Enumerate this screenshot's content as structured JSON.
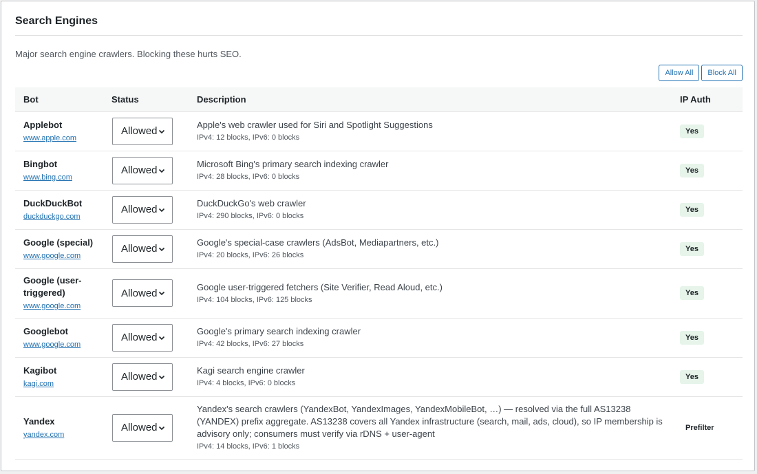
{
  "section": {
    "title": "Search Engines",
    "subtitle": "Major search engine crawlers. Blocking these hurts SEO."
  },
  "actions": {
    "allow_all": "Allow All",
    "block_all": "Block All"
  },
  "table": {
    "headers": {
      "bot": "Bot",
      "status": "Status",
      "description": "Description",
      "ip_auth": "IP Auth"
    },
    "rows": [
      {
        "name": "Applebot",
        "link": "www.apple.com",
        "status": "Allowed",
        "description": "Apple's web crawler used for Siri and Spotlight Suggestions",
        "blocks": "IPv4: 12 blocks, IPv6: 0 blocks",
        "ip_auth": "Yes",
        "ip_auth_kind": "yes"
      },
      {
        "name": "Bingbot",
        "link": "www.bing.com",
        "status": "Allowed",
        "description": "Microsoft Bing's primary search indexing crawler",
        "blocks": "IPv4: 28 blocks, IPv6: 0 blocks",
        "ip_auth": "Yes",
        "ip_auth_kind": "yes"
      },
      {
        "name": "DuckDuckBot",
        "link": "duckduckgo.com",
        "status": "Allowed",
        "description": "DuckDuckGo's web crawler",
        "blocks": "IPv4: 290 blocks, IPv6: 0 blocks",
        "ip_auth": "Yes",
        "ip_auth_kind": "yes"
      },
      {
        "name": "Google (special)",
        "link": "www.google.com",
        "status": "Allowed",
        "description": "Google's special-case crawlers (AdsBot, Mediapartners, etc.)",
        "blocks": "IPv4: 20 blocks, IPv6: 26 blocks",
        "ip_auth": "Yes",
        "ip_auth_kind": "yes"
      },
      {
        "name": "Google (user-triggered)",
        "link": "www.google.com",
        "status": "Allowed",
        "description": "Google user-triggered fetchers (Site Verifier, Read Aloud, etc.)",
        "blocks": "IPv4: 104 blocks, IPv6: 125 blocks",
        "ip_auth": "Yes",
        "ip_auth_kind": "yes"
      },
      {
        "name": "Googlebot",
        "link": "www.google.com",
        "status": "Allowed",
        "description": "Google's primary search indexing crawler",
        "blocks": "IPv4: 42 blocks, IPv6: 27 blocks",
        "ip_auth": "Yes",
        "ip_auth_kind": "yes"
      },
      {
        "name": "Kagibot",
        "link": "kagi.com",
        "status": "Allowed",
        "description": "Kagi search engine crawler",
        "blocks": "IPv4: 4 blocks, IPv6: 0 blocks",
        "ip_auth": "Yes",
        "ip_auth_kind": "yes"
      },
      {
        "name": "Yandex",
        "link": "yandex.com",
        "status": "Allowed",
        "description": "Yandex's search crawlers (YandexBot, YandexImages, YandexMobileBot, …) — resolved via the full AS13238 (YANDEX) prefix aggregate. AS13238 covers all Yandex infrastructure (search, mail, ads, cloud), so IP membership is advisory only; consumers must verify via rDNS + user-agent",
        "blocks": "IPv4: 14 blocks, IPv6: 1 blocks",
        "ip_auth": "Prefilter",
        "ip_auth_kind": "prefilter"
      }
    ]
  },
  "colors": {
    "accent": "#2271b1",
    "badge_yes_bg": "#e6f4ea"
  }
}
